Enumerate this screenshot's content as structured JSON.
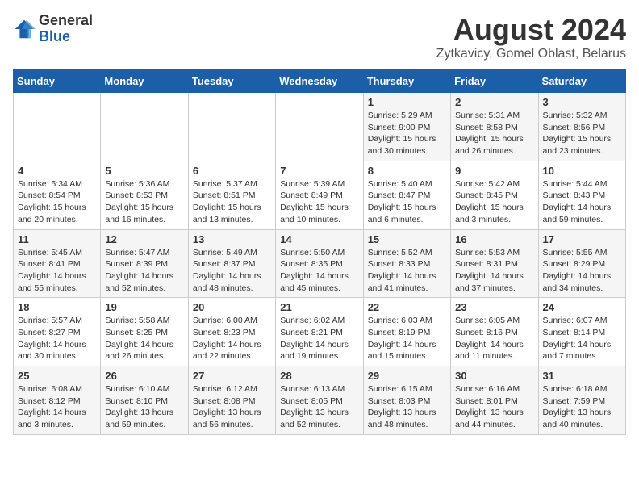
{
  "logo": {
    "general": "General",
    "blue": "Blue"
  },
  "title": "August 2024",
  "subtitle": "Zytkavicy, Gomel Oblast, Belarus",
  "days_of_week": [
    "Sunday",
    "Monday",
    "Tuesday",
    "Wednesday",
    "Thursday",
    "Friday",
    "Saturday"
  ],
  "weeks": [
    [
      {
        "day": "",
        "info": ""
      },
      {
        "day": "",
        "info": ""
      },
      {
        "day": "",
        "info": ""
      },
      {
        "day": "",
        "info": ""
      },
      {
        "day": "1",
        "info": "Sunrise: 5:29 AM\nSunset: 9:00 PM\nDaylight: 15 hours\nand 30 minutes."
      },
      {
        "day": "2",
        "info": "Sunrise: 5:31 AM\nSunset: 8:58 PM\nDaylight: 15 hours\nand 26 minutes."
      },
      {
        "day": "3",
        "info": "Sunrise: 5:32 AM\nSunset: 8:56 PM\nDaylight: 15 hours\nand 23 minutes."
      }
    ],
    [
      {
        "day": "4",
        "info": "Sunrise: 5:34 AM\nSunset: 8:54 PM\nDaylight: 15 hours\nand 20 minutes."
      },
      {
        "day": "5",
        "info": "Sunrise: 5:36 AM\nSunset: 8:53 PM\nDaylight: 15 hours\nand 16 minutes."
      },
      {
        "day": "6",
        "info": "Sunrise: 5:37 AM\nSunset: 8:51 PM\nDaylight: 15 hours\nand 13 minutes."
      },
      {
        "day": "7",
        "info": "Sunrise: 5:39 AM\nSunset: 8:49 PM\nDaylight: 15 hours\nand 10 minutes."
      },
      {
        "day": "8",
        "info": "Sunrise: 5:40 AM\nSunset: 8:47 PM\nDaylight: 15 hours\nand 6 minutes."
      },
      {
        "day": "9",
        "info": "Sunrise: 5:42 AM\nSunset: 8:45 PM\nDaylight: 15 hours\nand 3 minutes."
      },
      {
        "day": "10",
        "info": "Sunrise: 5:44 AM\nSunset: 8:43 PM\nDaylight: 14 hours\nand 59 minutes."
      }
    ],
    [
      {
        "day": "11",
        "info": "Sunrise: 5:45 AM\nSunset: 8:41 PM\nDaylight: 14 hours\nand 55 minutes."
      },
      {
        "day": "12",
        "info": "Sunrise: 5:47 AM\nSunset: 8:39 PM\nDaylight: 14 hours\nand 52 minutes."
      },
      {
        "day": "13",
        "info": "Sunrise: 5:49 AM\nSunset: 8:37 PM\nDaylight: 14 hours\nand 48 minutes."
      },
      {
        "day": "14",
        "info": "Sunrise: 5:50 AM\nSunset: 8:35 PM\nDaylight: 14 hours\nand 45 minutes."
      },
      {
        "day": "15",
        "info": "Sunrise: 5:52 AM\nSunset: 8:33 PM\nDaylight: 14 hours\nand 41 minutes."
      },
      {
        "day": "16",
        "info": "Sunrise: 5:53 AM\nSunset: 8:31 PM\nDaylight: 14 hours\nand 37 minutes."
      },
      {
        "day": "17",
        "info": "Sunrise: 5:55 AM\nSunset: 8:29 PM\nDaylight: 14 hours\nand 34 minutes."
      }
    ],
    [
      {
        "day": "18",
        "info": "Sunrise: 5:57 AM\nSunset: 8:27 PM\nDaylight: 14 hours\nand 30 minutes."
      },
      {
        "day": "19",
        "info": "Sunrise: 5:58 AM\nSunset: 8:25 PM\nDaylight: 14 hours\nand 26 minutes."
      },
      {
        "day": "20",
        "info": "Sunrise: 6:00 AM\nSunset: 8:23 PM\nDaylight: 14 hours\nand 22 minutes."
      },
      {
        "day": "21",
        "info": "Sunrise: 6:02 AM\nSunset: 8:21 PM\nDaylight: 14 hours\nand 19 minutes."
      },
      {
        "day": "22",
        "info": "Sunrise: 6:03 AM\nSunset: 8:19 PM\nDaylight: 14 hours\nand 15 minutes."
      },
      {
        "day": "23",
        "info": "Sunrise: 6:05 AM\nSunset: 8:16 PM\nDaylight: 14 hours\nand 11 minutes."
      },
      {
        "day": "24",
        "info": "Sunrise: 6:07 AM\nSunset: 8:14 PM\nDaylight: 14 hours\nand 7 minutes."
      }
    ],
    [
      {
        "day": "25",
        "info": "Sunrise: 6:08 AM\nSunset: 8:12 PM\nDaylight: 14 hours\nand 3 minutes."
      },
      {
        "day": "26",
        "info": "Sunrise: 6:10 AM\nSunset: 8:10 PM\nDaylight: 13 hours\nand 59 minutes."
      },
      {
        "day": "27",
        "info": "Sunrise: 6:12 AM\nSunset: 8:08 PM\nDaylight: 13 hours\nand 56 minutes."
      },
      {
        "day": "28",
        "info": "Sunrise: 6:13 AM\nSunset: 8:05 PM\nDaylight: 13 hours\nand 52 minutes."
      },
      {
        "day": "29",
        "info": "Sunrise: 6:15 AM\nSunset: 8:03 PM\nDaylight: 13 hours\nand 48 minutes."
      },
      {
        "day": "30",
        "info": "Sunrise: 6:16 AM\nSunset: 8:01 PM\nDaylight: 13 hours\nand 44 minutes."
      },
      {
        "day": "31",
        "info": "Sunrise: 6:18 AM\nSunset: 7:59 PM\nDaylight: 13 hours\nand 40 minutes."
      }
    ]
  ]
}
